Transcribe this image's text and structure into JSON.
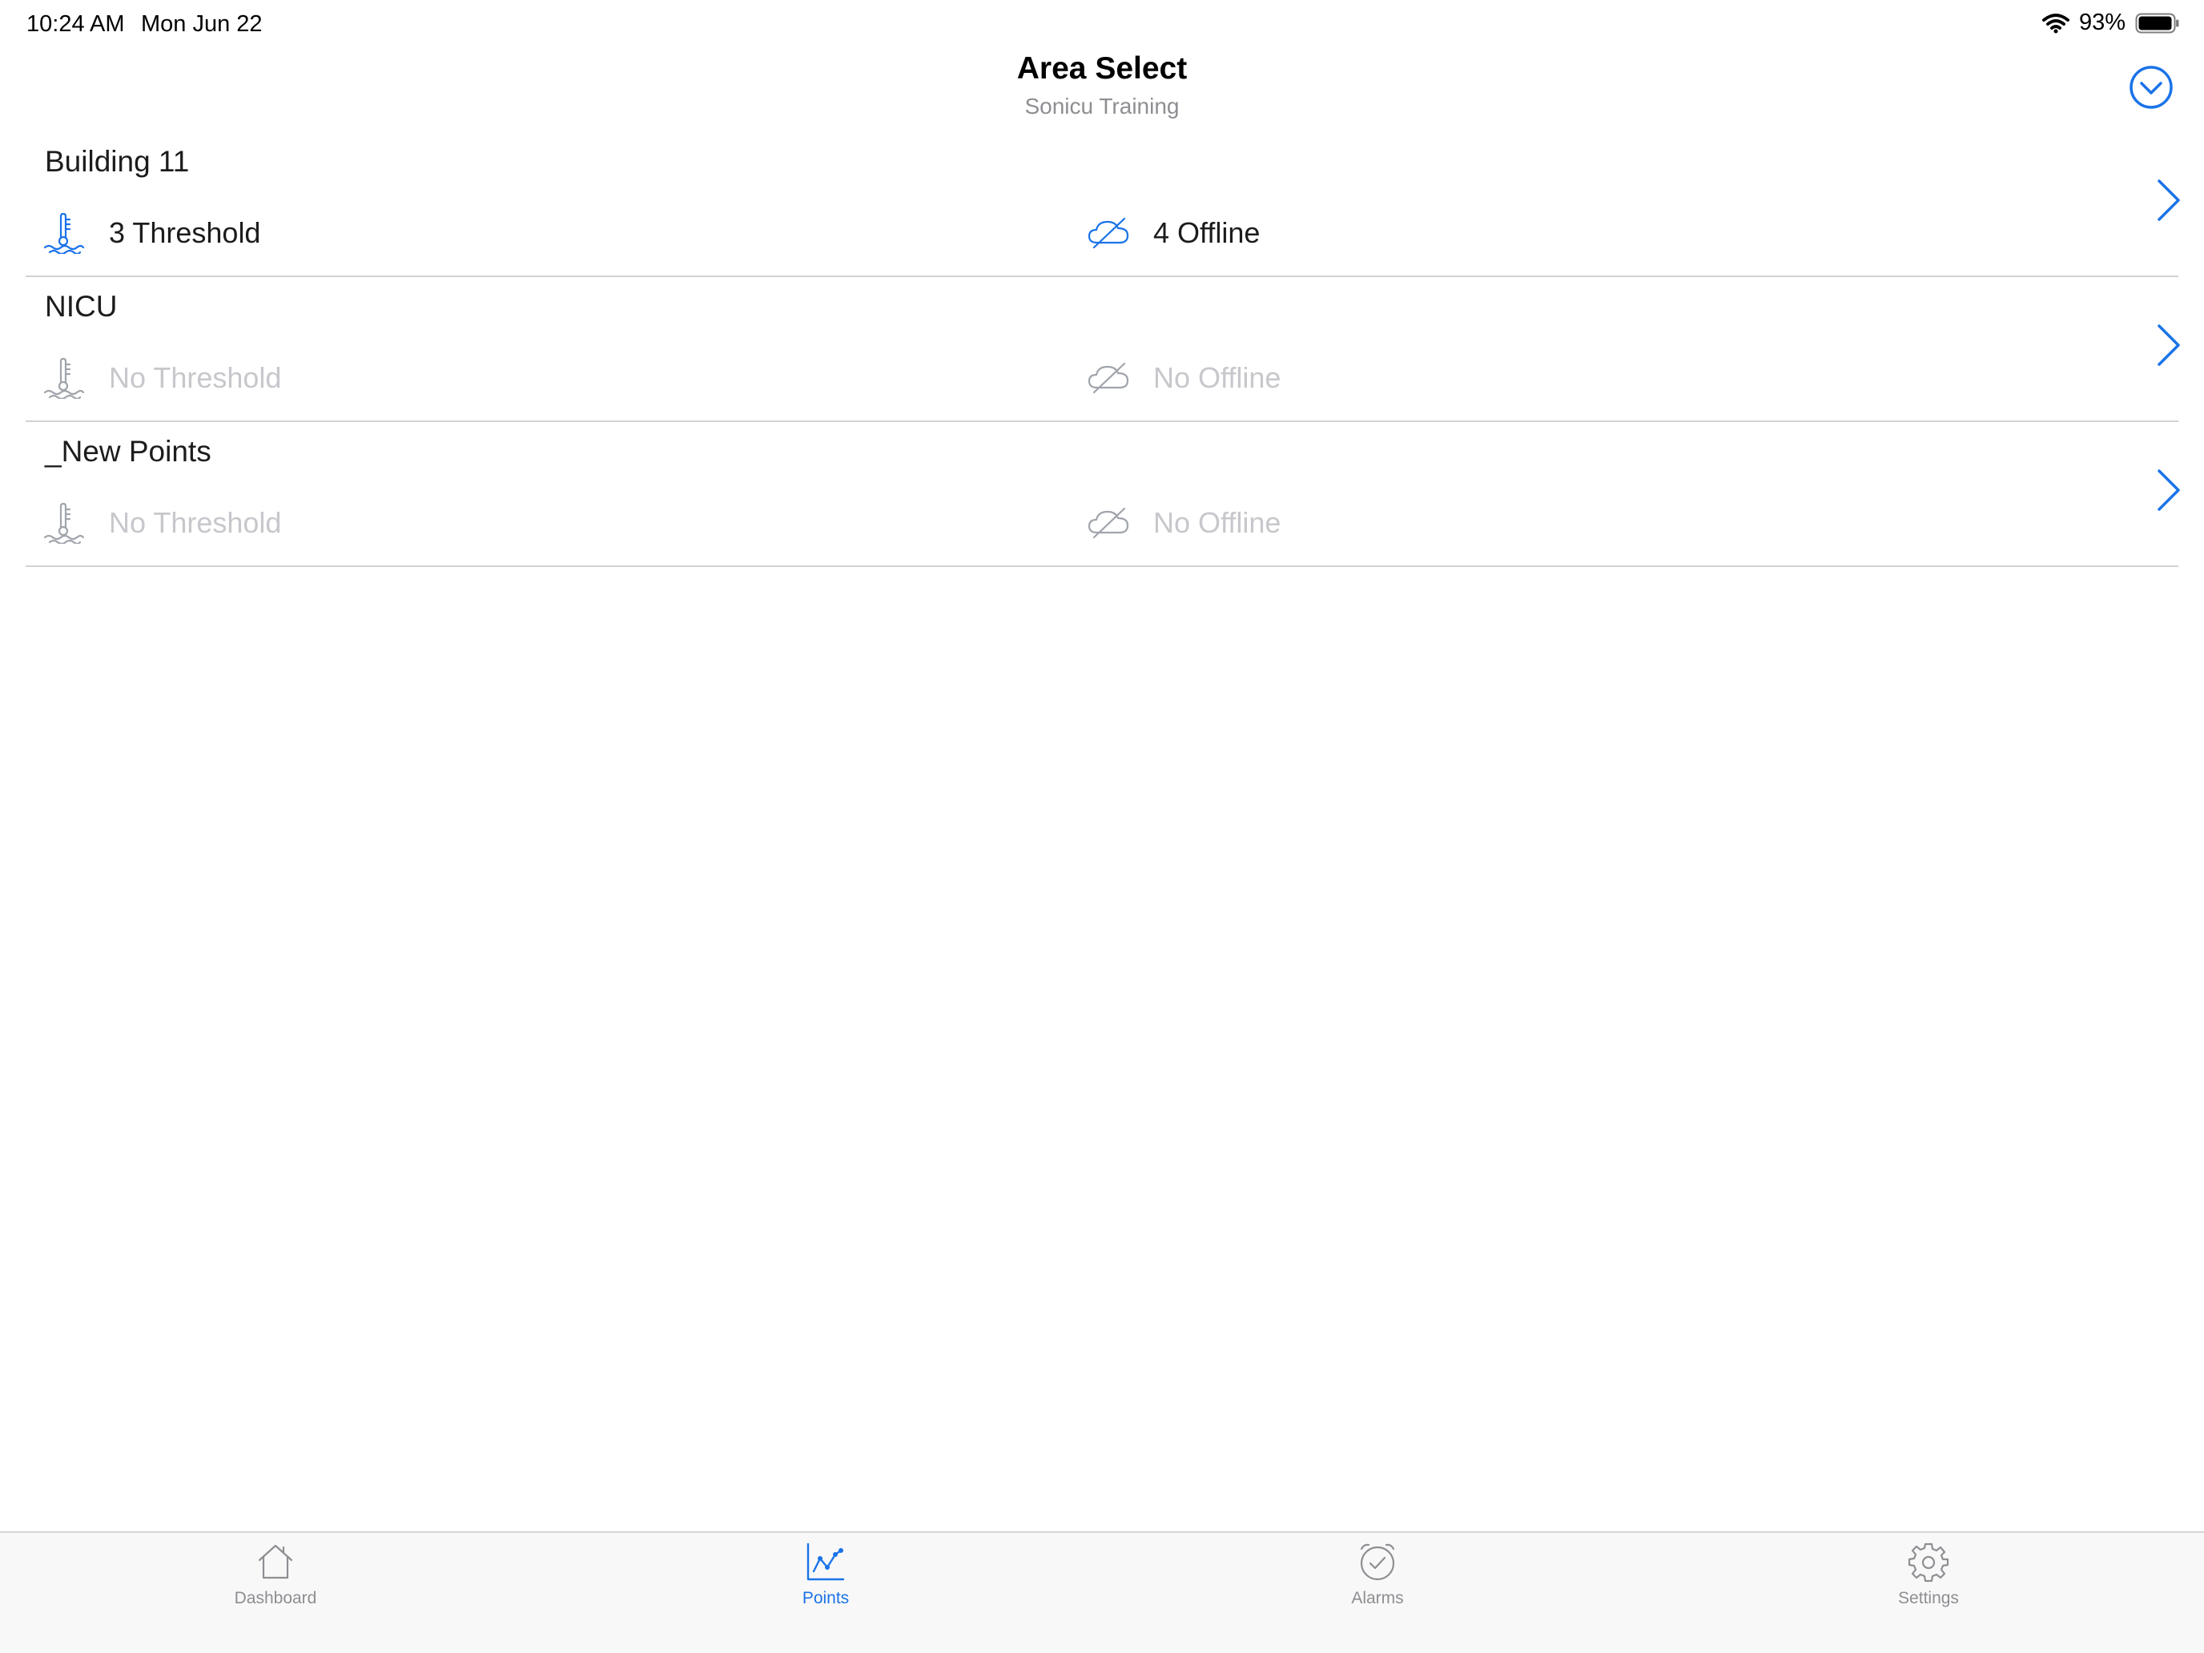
{
  "status_bar": {
    "time": "10:24 AM",
    "date": "Mon Jun 22",
    "battery_percent": "93%",
    "icons": [
      "wifi-icon",
      "battery-icon"
    ]
  },
  "header": {
    "title": "Area Select",
    "subtitle": "Sonicu Training",
    "action_icon": "chevron-down-circle-icon"
  },
  "areas": [
    {
      "name": "Building 11",
      "threshold": "3 Threshold",
      "offline": "4 Offline",
      "active": true
    },
    {
      "name": "NICU",
      "threshold": "No Threshold",
      "offline": "No Offline",
      "active": false
    },
    {
      "name": "_New Points",
      "threshold": "No Threshold",
      "offline": "No Offline",
      "active": false
    }
  ],
  "tabs": [
    {
      "label": "Dashboard",
      "icon": "house-icon",
      "selected": false
    },
    {
      "label": "Points",
      "icon": "chart-icon",
      "selected": true
    },
    {
      "label": "Alarms",
      "icon": "alarm-clock-icon",
      "selected": false
    },
    {
      "label": "Settings",
      "icon": "gear-icon",
      "selected": false
    }
  ],
  "colors": {
    "accent": "#1a73e8",
    "inactive_text": "#c7c7cc",
    "separator": "#d1d1d6",
    "tab_bar_bg": "#f8f8f8"
  }
}
